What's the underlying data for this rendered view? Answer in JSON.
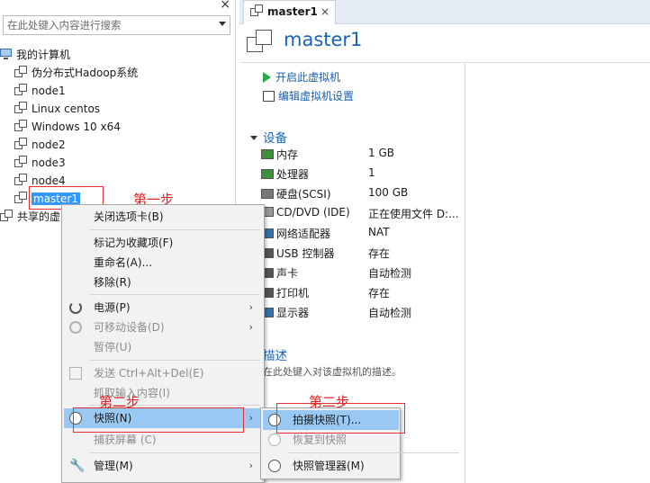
{
  "library": {
    "close_glyph": "×",
    "search_placeholder": "在此处键入内容进行搜索",
    "root_label": "我的计算机",
    "vms": [
      "伪分布式Hadoop系统",
      "node1",
      "Linux centos",
      "Windows 10 x64",
      "node2",
      "node3",
      "node4"
    ],
    "selected_vm": "master1",
    "shared_label": "共享的虚"
  },
  "annotations": {
    "step1": "第一步",
    "step2": "第二步",
    "step3": "第二步"
  },
  "tab": {
    "label": "master1",
    "close_glyph": "×"
  },
  "vm": {
    "title": "master1",
    "actions": {
      "power_on": "开启此虚拟机",
      "edit_settings": "编辑虚拟机设置"
    },
    "devices_heading": "设备",
    "devices": [
      {
        "name": "内存",
        "value": "1 GB",
        "icon": "memory-icon",
        "color": "#3f8f3f"
      },
      {
        "name": "处理器",
        "value": "1",
        "icon": "processor-icon",
        "color": "#3f8f3f"
      },
      {
        "name": "硬盘(SCSI)",
        "value": "100 GB",
        "icon": "harddisk-icon",
        "color": "#777777"
      },
      {
        "name": "CD/DVD (IDE)",
        "value": "正在使用文件 D:...",
        "icon": "cdrom-icon",
        "color": "#999999"
      },
      {
        "name": "网络适配器",
        "value": "NAT",
        "icon": "network-adapter-icon",
        "color": "#3a6ea8"
      },
      {
        "name": "USB 控制器",
        "value": "存在",
        "icon": "usb-icon",
        "color": "#555555"
      },
      {
        "name": "声卡",
        "value": "自动检测",
        "icon": "sound-card-icon",
        "color": "#555555"
      },
      {
        "name": "打印机",
        "value": "存在",
        "icon": "printer-icon",
        "color": "#555555"
      },
      {
        "name": "显示器",
        "value": "自动检测",
        "icon": "display-icon",
        "color": "#3a6ea8"
      }
    ],
    "description_heading": "描述",
    "description_placeholder": "在此处键入对该虚拟机的描述。"
  },
  "context_menu": {
    "close_tab": "关闭选项卡(B)",
    "mark_favorite": "标记为收藏项(F)",
    "rename": "重命名(A)...",
    "remove": "移除(R)",
    "power": "电源(P)",
    "removable_devices": "可移动设备(D)",
    "pause": "暂停(U)",
    "send_cad": "发送 Ctrl+Alt+Del(E)",
    "grab_input": "抓取输入内容(I)",
    "snapshot": "快照(N)",
    "capture_screen": "捕获屏幕 (C)",
    "manage": "管理(M)",
    "submenu_arrow": "›"
  },
  "snapshot_submenu": {
    "take": "拍摄快照(T)...",
    "revert": "恢复到快照",
    "manager": "快照管理器(M)"
  },
  "colors": {
    "accent": "#1a64b8",
    "highlight": "#99c9f2",
    "selection": "#3399ff",
    "annotation": "#e02020"
  }
}
